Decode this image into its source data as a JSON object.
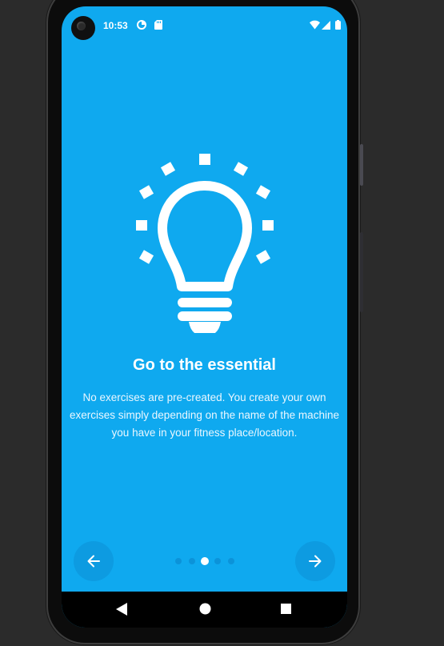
{
  "status_bar": {
    "time": "10:53",
    "left_icons": [
      "data-saver-icon",
      "sd-card-icon"
    ],
    "right_icons": [
      "wifi-icon",
      "signal-icon",
      "battery-icon"
    ]
  },
  "onboarding": {
    "illustration": "lightbulb-icon",
    "title": "Go to the essential",
    "description": "No exercises are pre-created. You create your own exercises simply depending on the name of the machine you have in your fitness place/location.",
    "page_count": 5,
    "current_page": 3,
    "back_icon": "arrow-left-icon",
    "next_icon": "arrow-right-icon"
  },
  "system_nav": {
    "buttons": [
      "back-triangle-icon",
      "home-circle-icon",
      "recents-square-icon"
    ]
  },
  "colors": {
    "background": "#0fa9ef",
    "foreground": "#ffffff",
    "nav_bar": "#000000"
  }
}
